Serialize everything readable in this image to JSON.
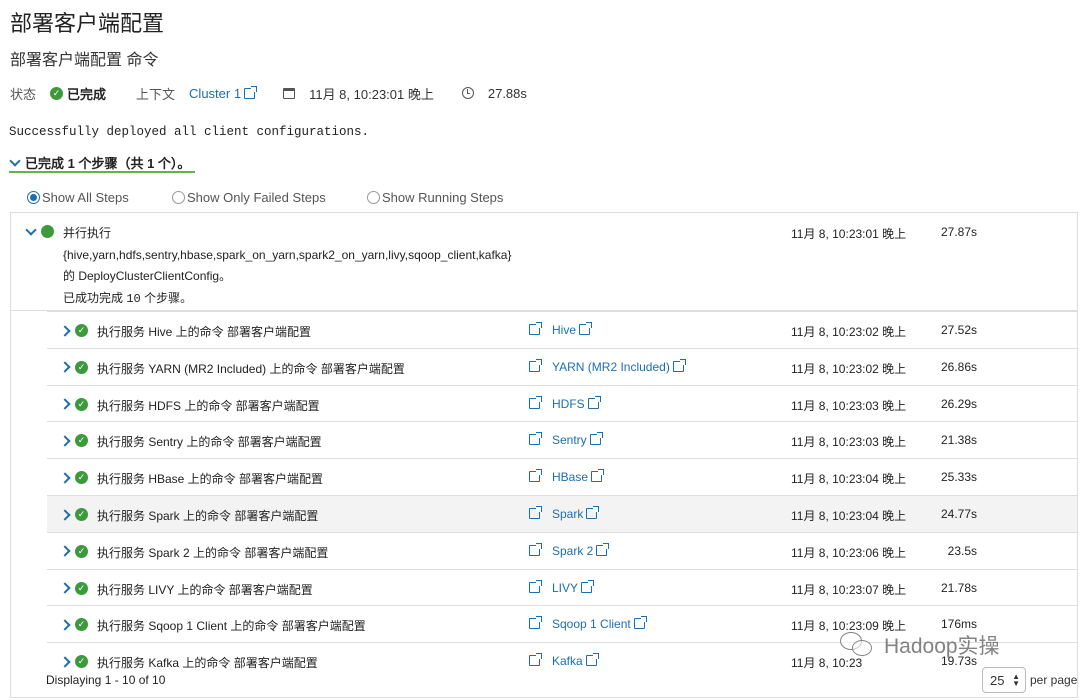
{
  "page": {
    "title": "部署客户端配置",
    "subtitle": "部署客户端配置 命令"
  },
  "status": {
    "label": "状态",
    "value": "已完成",
    "context_label": "上下文",
    "context_link": "Cluster 1",
    "date": "11月 8, 10:23:01 晚上",
    "duration": "27.88s"
  },
  "message": "Successfully deployed all client configurations.",
  "summary": "已完成 1 个步骤（共 1 个）。",
  "filters": {
    "all": "Show All Steps",
    "failed": "Show Only Failed Steps",
    "running": "Show Running Steps",
    "selected": "all"
  },
  "parent": {
    "line1": "并行执行",
    "line2": "{hive,yarn,hdfs,sentry,hbase,spark_on_yarn,spark2_on_yarn,livy,sqoop_client,kafka}",
    "line3": "的 DeployClusterClientConfig。",
    "line4_prefix": "已成功完成",
    "line4_count": "10",
    "line4_suffix": "个步骤。",
    "time": "11月 8, 10:23:01 晚上",
    "duration": "27.87s"
  },
  "steps": [
    {
      "desc": "执行服务 Hive 上的命令 部署客户端配置",
      "service": "Hive",
      "time": "11月 8, 10:23:02 晚上",
      "duration": "27.52s"
    },
    {
      "desc": "执行服务 YARN (MR2 Included) 上的命令 部署客户端配置",
      "service": "YARN (MR2 Included)",
      "time": "11月 8, 10:23:02 晚上",
      "duration": "26.86s"
    },
    {
      "desc": "执行服务 HDFS 上的命令 部署客户端配置",
      "service": "HDFS",
      "time": "11月 8, 10:23:03 晚上",
      "duration": "26.29s"
    },
    {
      "desc": "执行服务 Sentry 上的命令 部署客户端配置",
      "service": "Sentry",
      "time": "11月 8, 10:23:03 晚上",
      "duration": "21.38s"
    },
    {
      "desc": "执行服务 HBase 上的命令 部署客户端配置",
      "service": "HBase",
      "time": "11月 8, 10:23:04 晚上",
      "duration": "25.33s"
    },
    {
      "desc": "执行服务 Spark 上的命令 部署客户端配置",
      "service": "Spark",
      "time": "11月 8, 10:23:04 晚上",
      "duration": "24.77s"
    },
    {
      "desc": "执行服务 Spark 2 上的命令 部署客户端配置",
      "service": "Spark 2",
      "time": "11月 8, 10:23:06 晚上",
      "duration": "23.5s"
    },
    {
      "desc": "执行服务 LIVY 上的命令 部署客户端配置",
      "service": "LIVY",
      "time": "11月 8, 10:23:07 晚上",
      "duration": "21.78s"
    },
    {
      "desc": "执行服务 Sqoop 1 Client 上的命令 部署客户端配置",
      "service": "Sqoop 1 Client",
      "time": "11月 8, 10:23:09 晚上",
      "duration": "176ms"
    },
    {
      "desc": "执行服务 Kafka 上的命令 部署客户端配置",
      "service": "Kafka",
      "time": "11月 8, 10:23",
      "duration": "19.73s"
    }
  ],
  "footer": {
    "displaying": "Displaying 1 - 10 of 10",
    "page_size": "25",
    "per_page": "per page"
  },
  "watermark": "Hadoop实操",
  "colors": {
    "success": "#3c9a3c",
    "link": "#1a6fb3",
    "underline": "#6ab04c"
  }
}
